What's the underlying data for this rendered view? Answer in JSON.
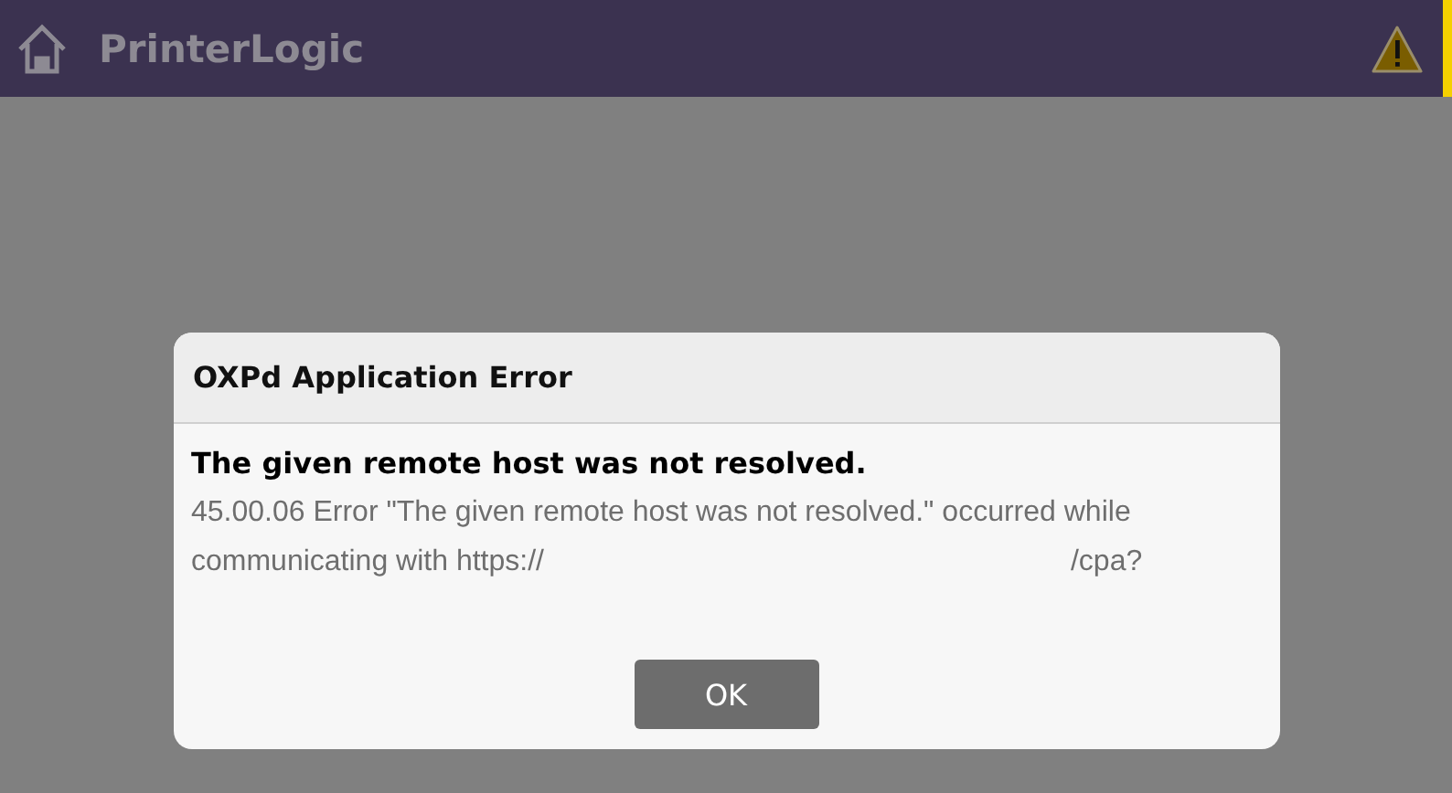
{
  "header": {
    "title": "PrinterLogic"
  },
  "dialog": {
    "title": "OXPd Application Error",
    "heading": "The given remote host was not resolved.",
    "message_lines": [
      "45.00.06 Error \"The given remote host was not resolved.\" occurred while",
      "communicating with https://"
    ],
    "message_tail": "/cpa?",
    "buttons": [
      "OK"
    ]
  }
}
